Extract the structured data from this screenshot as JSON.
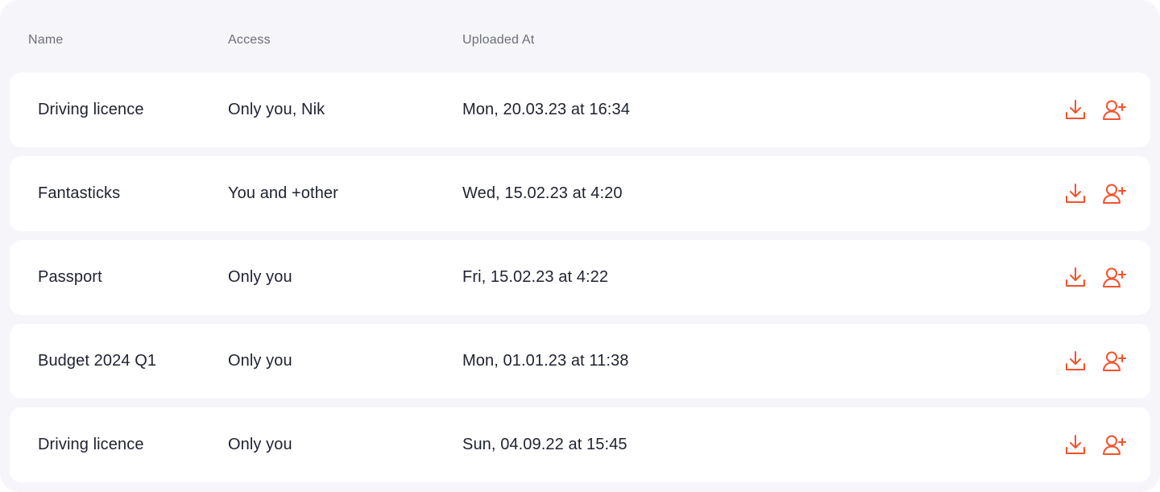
{
  "colors": {
    "accent": "#f0532c",
    "panel_background": "#f6f5fa",
    "row_background": "#ffffff",
    "header_text": "#6b6e7a",
    "body_text": "#1f2230"
  },
  "table": {
    "columns": {
      "name": "Name",
      "access": "Access",
      "uploaded_at": "Uploaded At"
    },
    "rows": [
      {
        "name": "Driving licence",
        "access": "Only you, Nik",
        "uploaded_at": "Mon, 20.03.23 at 16:34"
      },
      {
        "name": "Fantasticks",
        "access": "You and +other",
        "uploaded_at": "Wed, 15.02.23 at 4:20"
      },
      {
        "name": "Passport",
        "access": "Only you",
        "uploaded_at": "Fri, 15.02.23 at 4:22"
      },
      {
        "name": "Budget 2024 Q1",
        "access": "Only you",
        "uploaded_at": "Mon, 01.01.23 at 11:38"
      },
      {
        "name": "Driving licence",
        "access": "Only you",
        "uploaded_at": "Sun, 04.09.22 at 15:45"
      }
    ],
    "row_actions": [
      {
        "icon": "download-icon"
      },
      {
        "icon": "add-user-icon"
      }
    ]
  }
}
